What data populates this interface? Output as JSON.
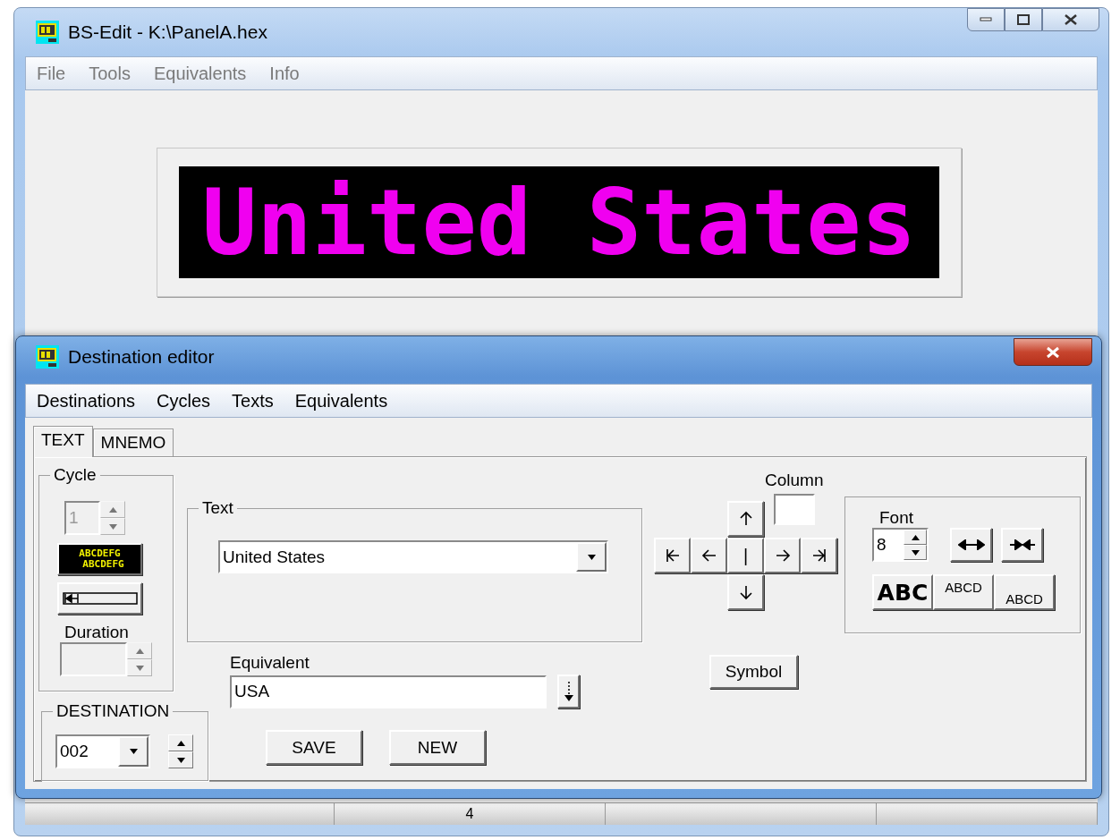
{
  "main_window": {
    "title": "BS-Edit - K:\\PanelA.hex",
    "menu": [
      "File",
      "Tools",
      "Equivalents",
      "Info"
    ],
    "led_display": {
      "text": "United States"
    },
    "status_bar": {
      "cell_2": "4"
    }
  },
  "dialog": {
    "title": "Destination editor",
    "menu": [
      "Destinations",
      "Cycles",
      "Texts",
      "Equivalents"
    ],
    "tabs": [
      {
        "label": "TEXT",
        "selected": true
      },
      {
        "label": "MNEMO",
        "selected": false
      }
    ],
    "cycle": {
      "label": "Cycle",
      "value": "1",
      "disabled": true,
      "preview_lines": [
        "ABCDEFG",
        "ABCDEFG"
      ],
      "duration_label": "Duration",
      "duration_disabled": true
    },
    "destination": {
      "label": "DESTINATION",
      "value": "002"
    },
    "text_group": {
      "label": "Text",
      "value": "United States"
    },
    "equivalent": {
      "label": "Equivalent",
      "value": "USA"
    },
    "buttons": [
      "SAVE",
      "NEW"
    ],
    "column": {
      "label": "Column"
    },
    "cursor_button": "|",
    "symbol_button": "Symbol",
    "font": {
      "label": "Font",
      "size": "8",
      "style_buttons": [
        {
          "label": "ABC",
          "kind": "bold"
        },
        {
          "label": "ABCD",
          "kind": "raised"
        },
        {
          "label": "ABCD",
          "kind": "lowered"
        }
      ]
    }
  }
}
